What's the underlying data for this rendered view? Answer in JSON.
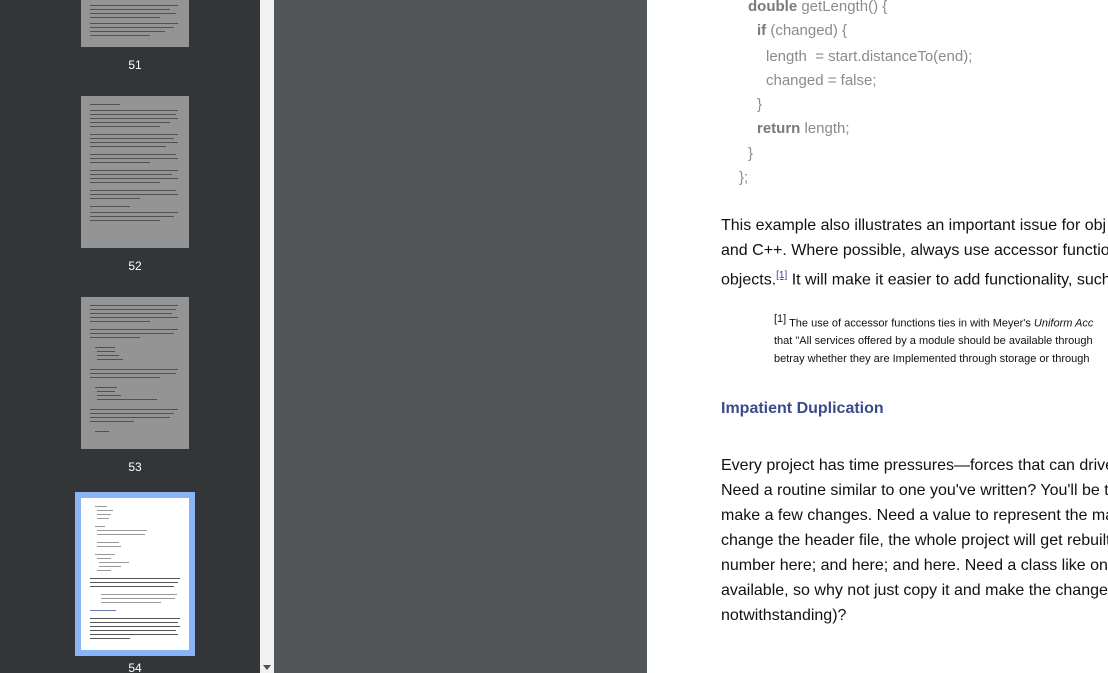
{
  "thumbnails": [
    {
      "number": "51",
      "selected": false
    },
    {
      "number": "52",
      "selected": false
    },
    {
      "number": "53",
      "selected": false
    },
    {
      "number": "54",
      "selected": true
    }
  ],
  "code": {
    "line1_kw": "double",
    "line1_rest": " getLength() {",
    "line2_kw": "if",
    "line2_rest": " (changed) {",
    "line3": "length  = start.distanceTo(end);",
    "line4": "changed = false;",
    "line5": "}",
    "line6_kw": "return",
    "line6_rest": " length;",
    "line7": "}",
    "line8": "};"
  },
  "paragraph1": {
    "line1": "This example also illustrates an important issue for obj",
    "line2": "and C++. Where possible, always use accessor functio",
    "line3a": "objects.",
    "ref": "[1]",
    "line3b": " It will make it easier to add functionality, such"
  },
  "footnote": {
    "ref": "[1]",
    "line1a": " The use of accessor functions ties in with Meyer's ",
    "line1b": "Uniform Acc",
    "line2": "that \"All services offered by a module should be available through",
    "line3": "betray whether they are Implemented through storage or through"
  },
  "heading": "Impatient Duplication",
  "paragraph2": [
    "Every project has time pressures—forces that can drive",
    "Need a routine similar to one you've written? You'll be t",
    "make a few changes. Need a value to represent the ma",
    "change the header file, the whole project will get rebuilt",
    "number here; and here; and here. Need a class like on",
    "available, so why not just copy it and make the change",
    "notwithstanding)?"
  ],
  "colors": {
    "accent": "#8ab4f8",
    "heading": "#3b4a8a",
    "sidebar": "#323639",
    "viewer": "#525659"
  }
}
